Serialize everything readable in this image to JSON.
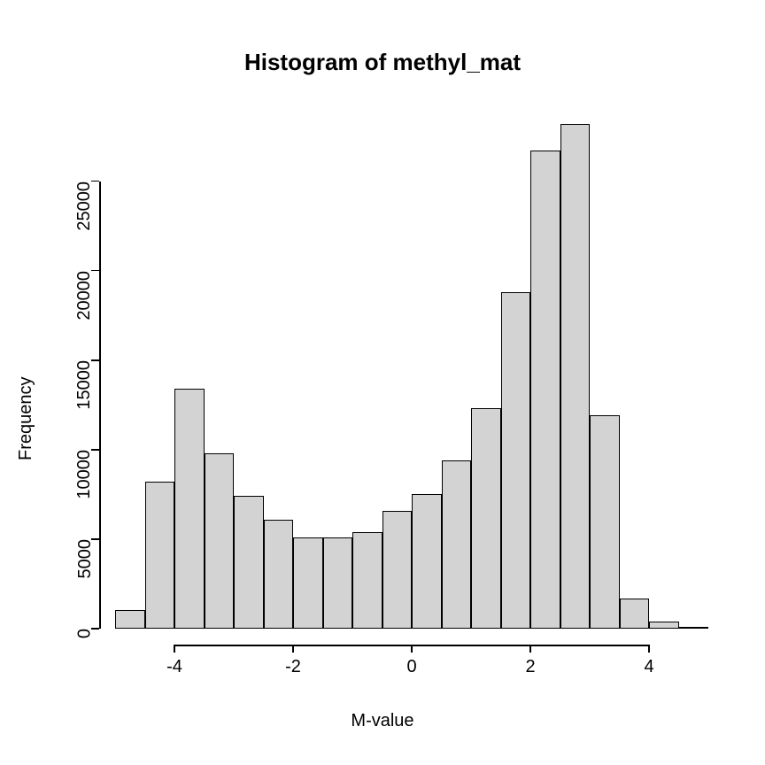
{
  "chart_data": {
    "type": "bar",
    "title": "Histogram of methyl_mat",
    "xlabel": "M-value",
    "ylabel": "Frequency",
    "xlim": [
      -5.0,
      5.0
    ],
    "ylim": [
      0,
      28200
    ],
    "x_ticks": [
      -4,
      -2,
      0,
      2,
      4
    ],
    "y_ticks": [
      0,
      5000,
      10000,
      15000,
      20000,
      25000
    ],
    "bin_width": 0.5,
    "categories": [
      -5.0,
      -4.5,
      -4.0,
      -3.5,
      -3.0,
      -2.5,
      -2.0,
      -1.5,
      -1.0,
      -0.5,
      0.0,
      0.5,
      1.0,
      1.5,
      2.0,
      2.5,
      3.0,
      3.5,
      4.0,
      4.5
    ],
    "values": [
      1050,
      8200,
      13400,
      9800,
      7400,
      6100,
      5100,
      5100,
      5400,
      6600,
      7500,
      9400,
      12300,
      18800,
      26700,
      28200,
      11900,
      1700,
      400,
      100
    ]
  }
}
